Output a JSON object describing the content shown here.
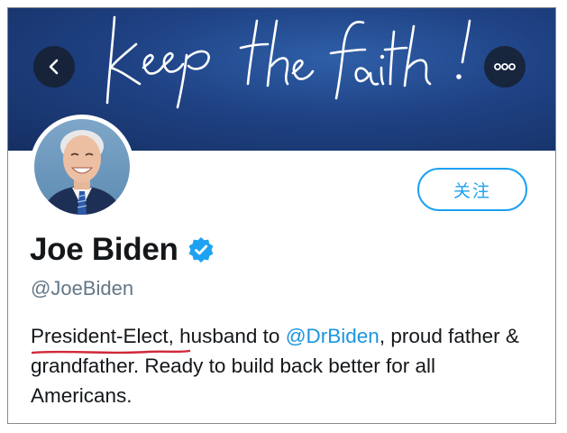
{
  "banner": {
    "script_text": "keep the faith!",
    "color": "#1f4284"
  },
  "header": {
    "back_icon": "chevron-left-icon",
    "more_icon": "more-horizontal-icon"
  },
  "profile": {
    "name": "Joe Biden",
    "verified": true,
    "handle": "@JoeBiden",
    "follow_label": "关注",
    "bio": {
      "title": "President-Elect",
      "part1": ", husband to ",
      "mention": "@DrBiden",
      "part2": ", proud father & grandfather. Ready to build back better for all Americans."
    }
  },
  "colors": {
    "accent": "#1da1f2",
    "mention": "#1b95e0",
    "underline": "#d0283a"
  }
}
